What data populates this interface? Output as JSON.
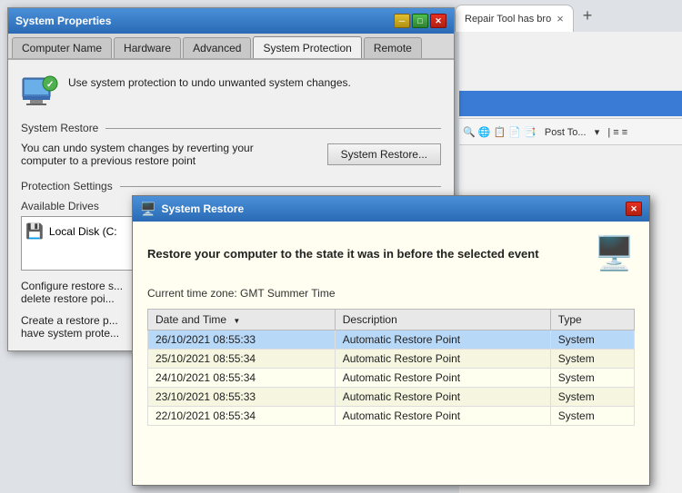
{
  "browser": {
    "tab_label": "Repair Tool has bro",
    "close_label": "×",
    "new_tab_label": "+",
    "blue_bar": true
  },
  "system_properties": {
    "title": "System Properties",
    "tabs": [
      {
        "id": "computer-name",
        "label": "Computer Name"
      },
      {
        "id": "hardware",
        "label": "Hardware"
      },
      {
        "id": "advanced",
        "label": "Advanced"
      },
      {
        "id": "system-protection",
        "label": "System Protection",
        "active": true
      },
      {
        "id": "remote",
        "label": "Remote"
      }
    ],
    "active_tab": {
      "header_text": "Use system protection to undo unwanted system changes.",
      "system_restore_section": "System Restore",
      "system_restore_desc": "You can undo system changes by reverting your\ncomputer to a previous restore point",
      "system_restore_btn": "System Restore...",
      "protection_settings_label": "Protection Settings",
      "available_drives_label": "Available Drives",
      "drive_name": "Local Disk (C:",
      "configure_text": "Configure restore s...\ndelete restore poi...",
      "create_text": "Create a restore p...\nhave system prote..."
    }
  },
  "system_restore_dialog": {
    "title": "System Restore",
    "bold_text": "Restore your computer to the state it was in before the selected event",
    "timezone_text": "Current time zone: GMT Summer Time",
    "table": {
      "columns": [
        {
          "id": "datetime",
          "label": "Date and Time"
        },
        {
          "id": "description",
          "label": "Description"
        },
        {
          "id": "type",
          "label": "Type"
        }
      ],
      "rows": [
        {
          "datetime": "26/10/2021 08:55:33",
          "description": "Automatic Restore Point",
          "type": "System",
          "selected": true
        },
        {
          "datetime": "25/10/2021 08:55:34",
          "description": "Automatic Restore Point",
          "type": "System"
        },
        {
          "datetime": "24/10/2021 08:55:34",
          "description": "Automatic Restore Point",
          "type": "System"
        },
        {
          "datetime": "23/10/2021 08:55:33",
          "description": "Automatic Restore Point",
          "type": "System"
        },
        {
          "datetime": "22/10/2021 08:55:34",
          "description": "Automatic Restore Point",
          "type": "System"
        }
      ]
    }
  },
  "icons": {
    "shield": "🛡️",
    "computer": "🖥️",
    "drive": "💾",
    "restore": "🔄",
    "window_close": "✕",
    "window_minimize": "─",
    "window_maximize": "□",
    "sr_icon": "🖥️"
  }
}
